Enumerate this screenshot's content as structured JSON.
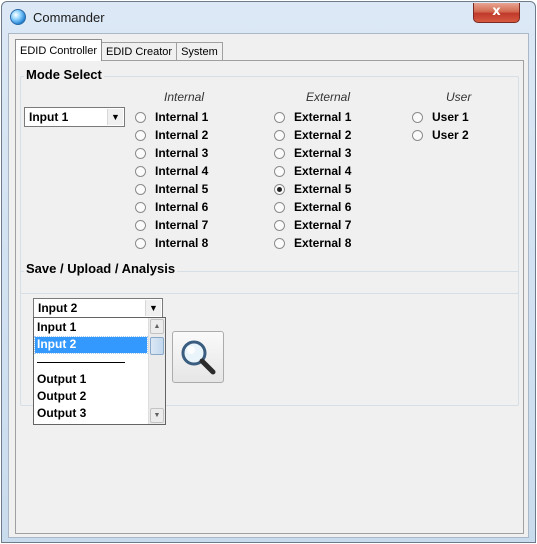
{
  "window": {
    "title": "Commander",
    "close_label": "x"
  },
  "tabs": [
    {
      "label": "EDID Controller",
      "active": true
    },
    {
      "label": "EDID Creator",
      "active": false
    },
    {
      "label": "System",
      "active": false
    }
  ],
  "mode_select": {
    "title": "Mode Select",
    "input_combo_value": "Input 1",
    "headers": {
      "internal": "Internal",
      "external": "External",
      "user": "User"
    },
    "internal": [
      "Internal 1",
      "Internal 2",
      "Internal 3",
      "Internal 4",
      "Internal 5",
      "Internal 6",
      "Internal 7",
      "Internal 8"
    ],
    "external": [
      "External 1",
      "External 2",
      "External 3",
      "External 4",
      "External 5",
      "External 6",
      "External 7",
      "External 8"
    ],
    "user": [
      "User 1",
      "User 2"
    ],
    "selected": "External 5"
  },
  "save_upload": {
    "title": "Save / Upload / Analysis",
    "combo_value": "Input 2",
    "dropdown_items": [
      "Input 1",
      "Input 2",
      "Output 1",
      "Output 2",
      "Output 3"
    ],
    "dropdown_selected": "Input 2",
    "analyze_icon": "magnifier-icon"
  },
  "colors": {
    "selection": "#3399ff",
    "close_button": "#c0392b",
    "window_frame": "#c9dcee"
  }
}
